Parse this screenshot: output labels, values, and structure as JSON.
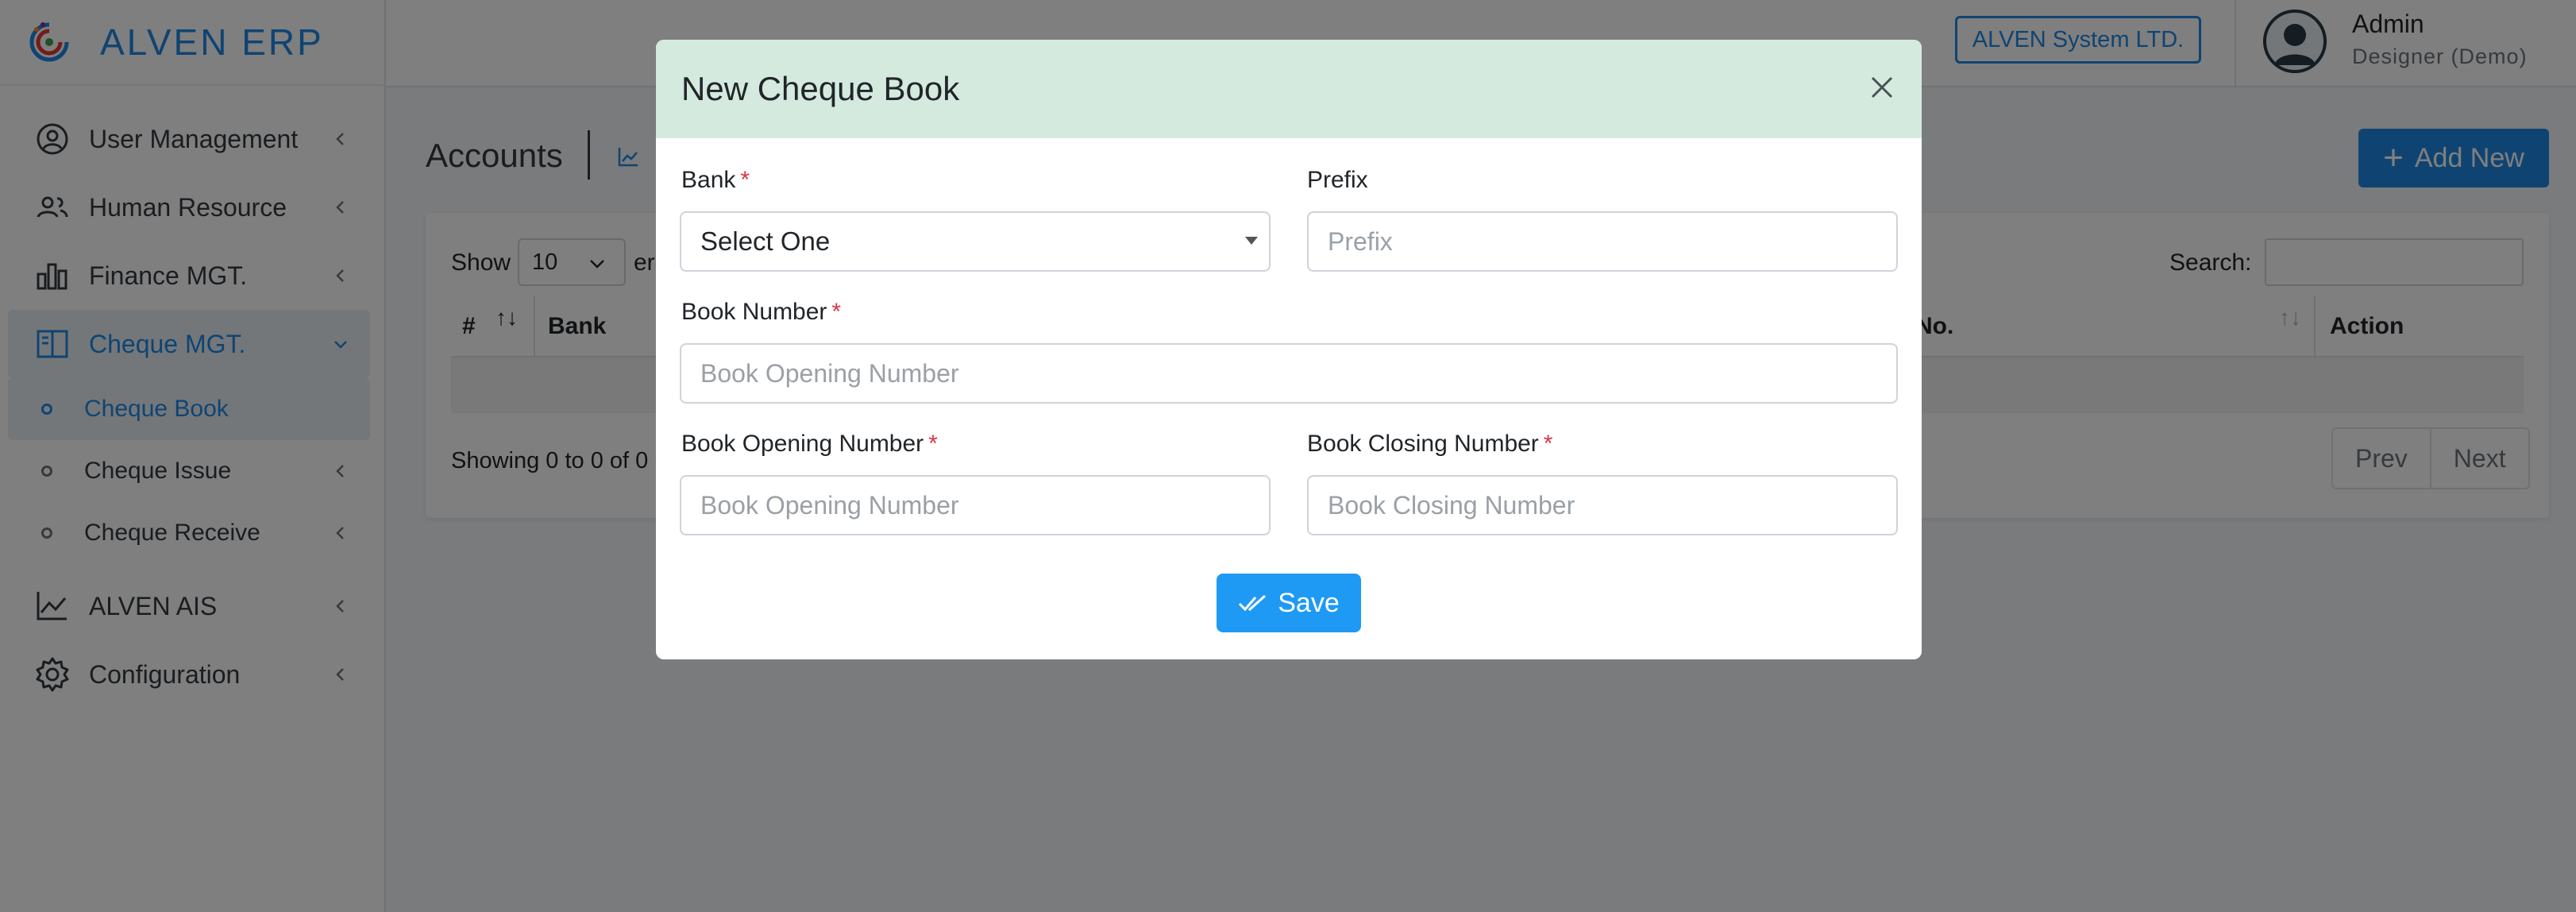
{
  "brand": {
    "name": "ALVEN ERP"
  },
  "sidebar": {
    "items": [
      {
        "label": "User Management",
        "icon": "user-circle-icon"
      },
      {
        "label": "Human Resource",
        "icon": "users-icon"
      },
      {
        "label": "Finance MGT.",
        "icon": "bar-chart-icon"
      },
      {
        "label": "Cheque MGT.",
        "icon": "book-icon",
        "active": true,
        "children": [
          {
            "label": "Cheque Book",
            "active": true
          },
          {
            "label": "Cheque Issue"
          },
          {
            "label": "Cheque Receive"
          }
        ]
      },
      {
        "label": "ALVEN AIS",
        "icon": "line-chart-icon"
      },
      {
        "label": "Configuration",
        "icon": "gear-icon"
      }
    ]
  },
  "topbar": {
    "company": "ALVEN System LTD.",
    "user": {
      "name": "Admin",
      "role": "Designer (Demo)"
    }
  },
  "page": {
    "title": "Accounts",
    "add_label": "Add New"
  },
  "table": {
    "show_label": "Show",
    "page_size": "10",
    "entries_tail": "er",
    "search_label": "Search:",
    "headers": [
      "#",
      "Bank",
      "No.",
      "Action"
    ],
    "info": "Showing 0 to 0 of 0",
    "prev": "Prev",
    "next": "Next"
  },
  "modal": {
    "title": "New Cheque Book",
    "fields": {
      "bank": {
        "label": "Bank",
        "required": true,
        "value": "Select One"
      },
      "prefix": {
        "label": "Prefix",
        "required": false,
        "placeholder": "Prefix"
      },
      "book_number": {
        "label": "Book Number",
        "required": true,
        "placeholder": "Book Opening Number"
      },
      "opening": {
        "label": "Book Opening Number",
        "required": true,
        "placeholder": "Book Opening Number"
      },
      "closing": {
        "label": "Book Closing Number",
        "required": true,
        "placeholder": "Book Closing Number"
      }
    },
    "save_label": "Save",
    "required_mark": "*"
  },
  "colors": {
    "primary": "#1e88e5",
    "modal_header": "#d4eadf",
    "required": "#dc3545",
    "save": "#1e9af5"
  }
}
